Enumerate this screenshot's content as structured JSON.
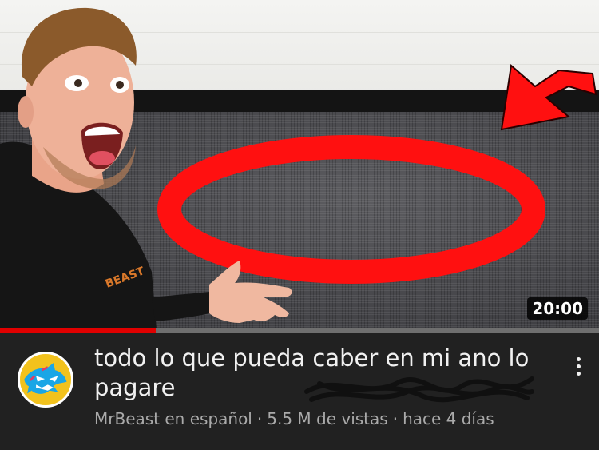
{
  "video": {
    "title": "todo lo que pueda caber en mi ano lo pagare",
    "channel": "MrBeast en español",
    "views": "5.5 M de vistas",
    "age": "hace 4 días",
    "separator": "·",
    "duration": "20:00",
    "watched_fraction": 0.26,
    "shirt_text": "BEAST"
  },
  "icons": {
    "more": "more-vert-icon",
    "avatar": "mrbeast-logo-avatar"
  },
  "colors": {
    "background": "#212121",
    "progress": "#e00000",
    "ring": "#ff1010",
    "title_text": "#f1f1f1",
    "meta_text": "#aaaaaa",
    "avatar_bg": "#f2c21d"
  }
}
